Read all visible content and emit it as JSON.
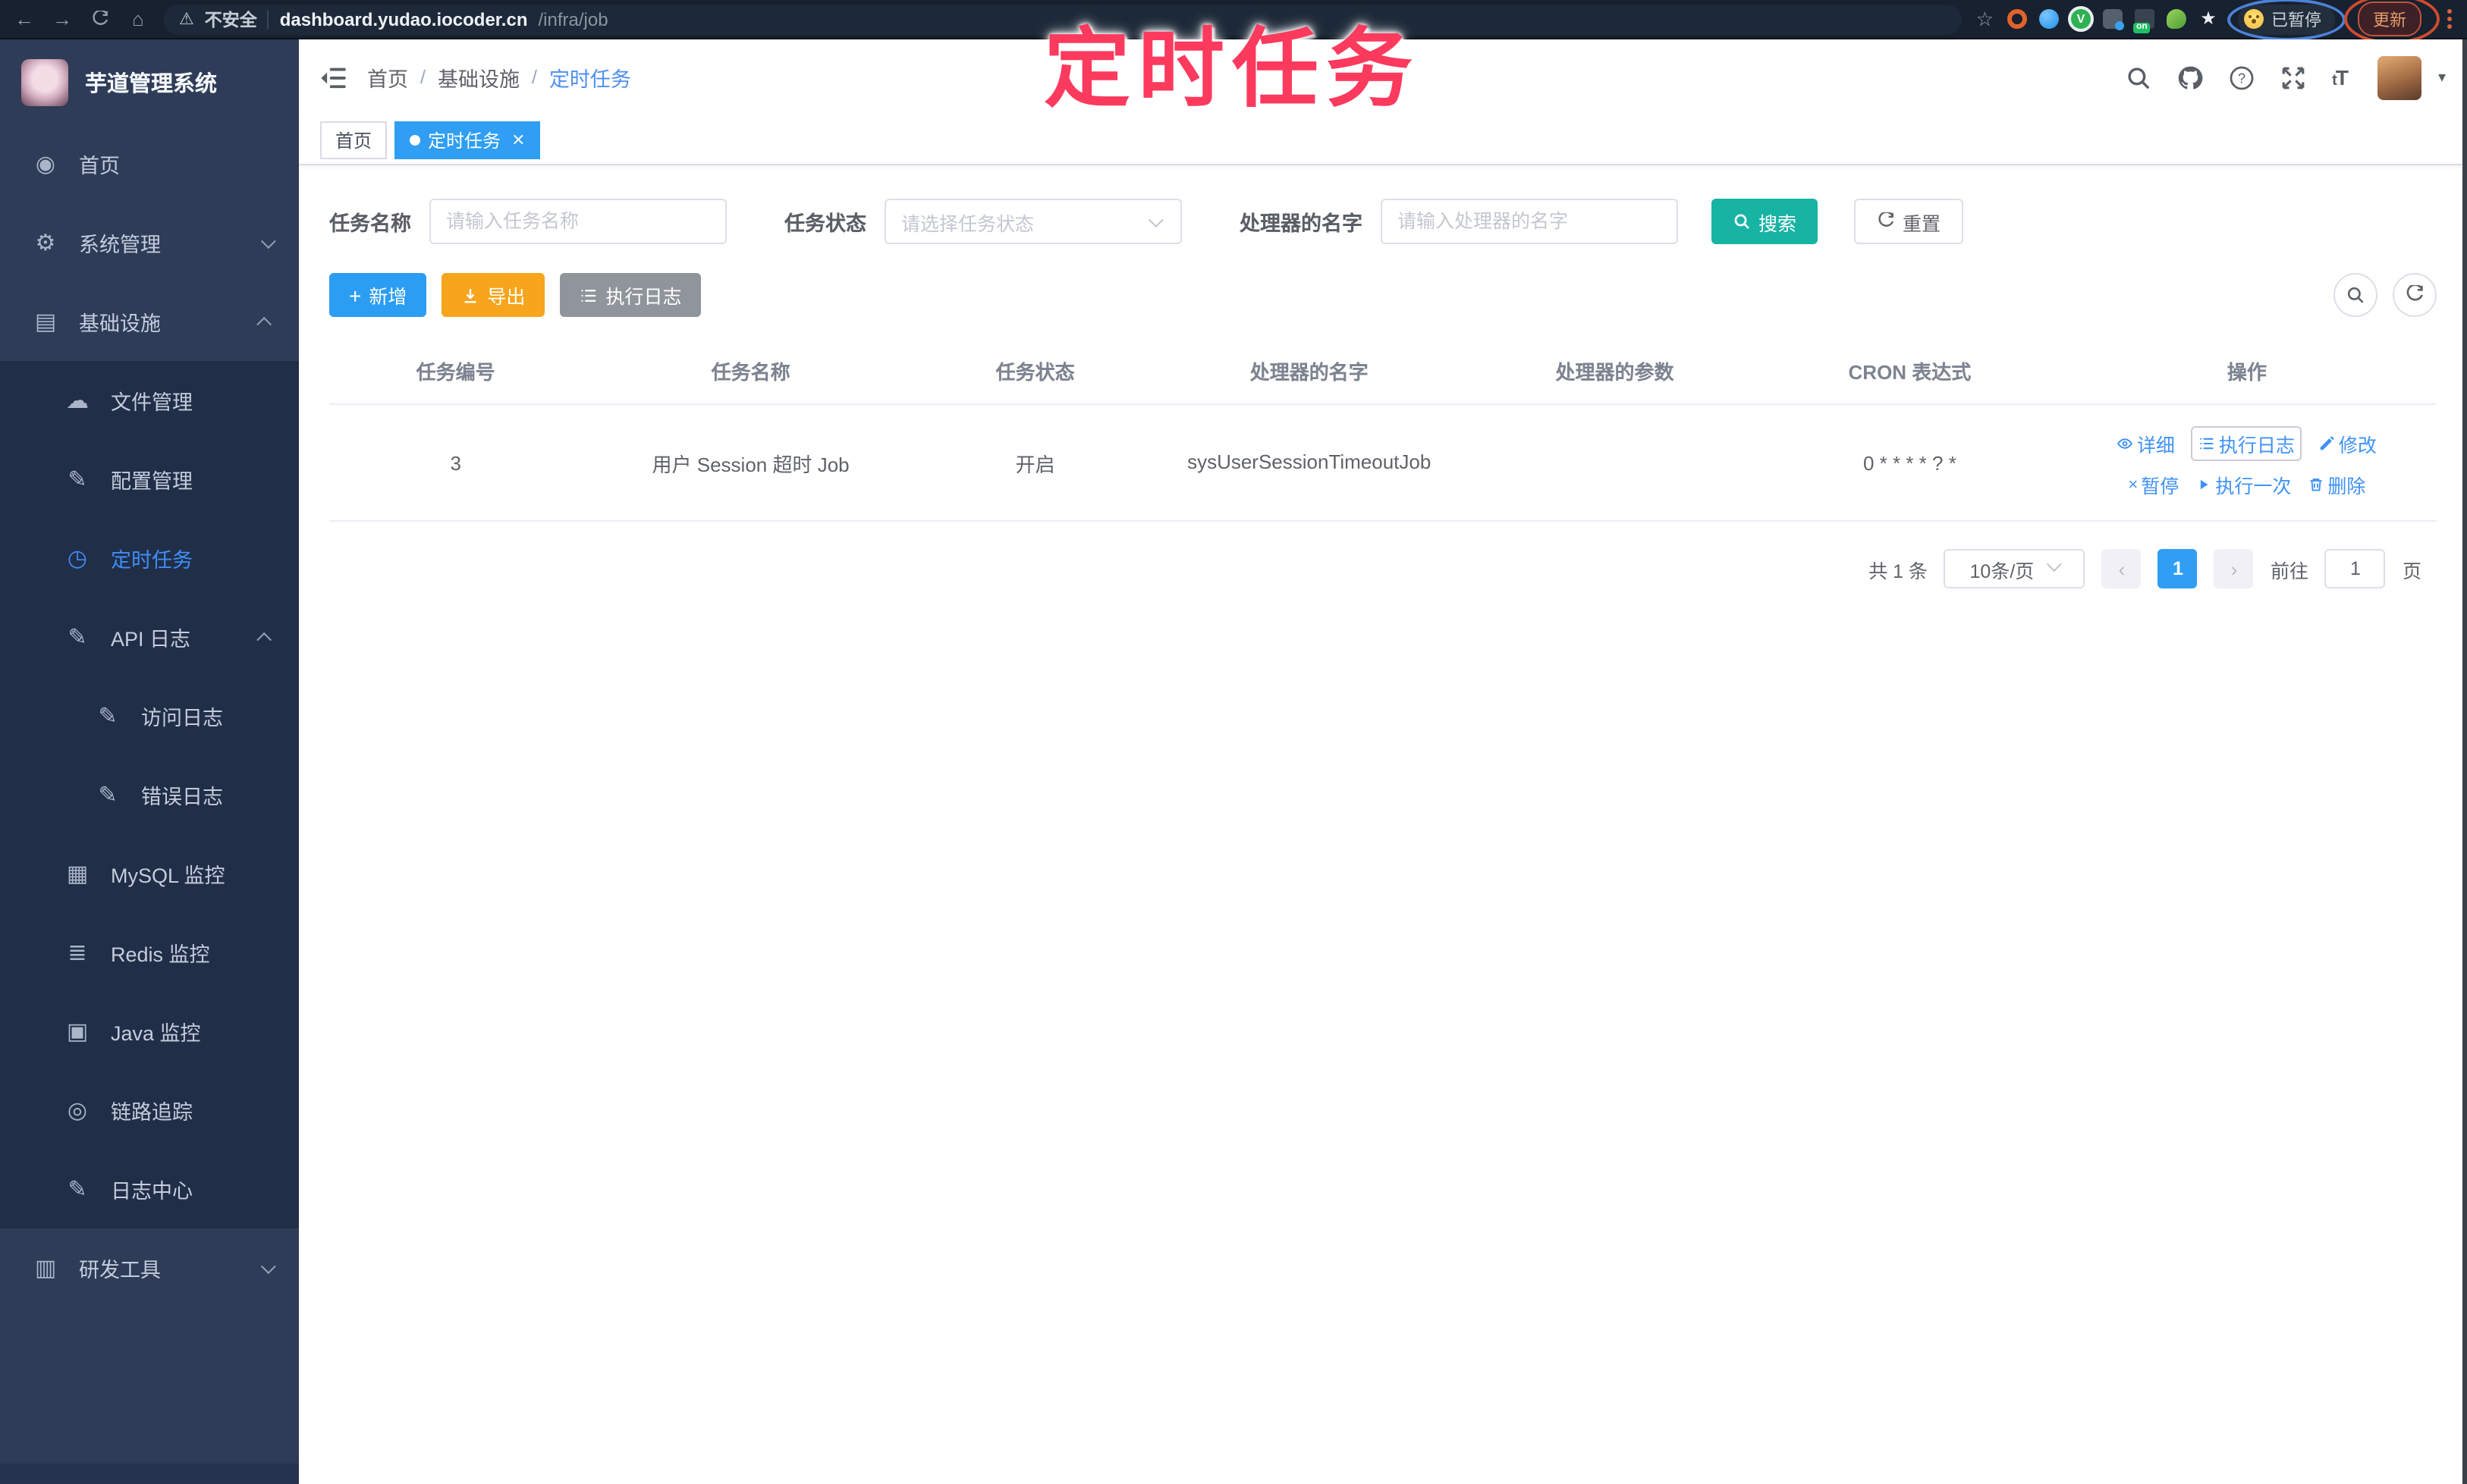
{
  "browser": {
    "security_label": "不安全",
    "url_host": "dashboard.yudao.iocoder.cn",
    "url_path": "/infra/job",
    "extension_on_badge": "on",
    "paused_badge": "已暂停",
    "update_label": "更新"
  },
  "annotation": {
    "title": "定时任务"
  },
  "sidebar": {
    "title": "芋道管理系统",
    "items": [
      {
        "label": "首页"
      },
      {
        "label": "系统管理"
      },
      {
        "label": "基础设施"
      },
      {
        "label": "文件管理"
      },
      {
        "label": "配置管理"
      },
      {
        "label": "定时任务"
      },
      {
        "label": "API 日志"
      },
      {
        "label": "访问日志"
      },
      {
        "label": "错误日志"
      },
      {
        "label": "MySQL 监控"
      },
      {
        "label": "Redis 监控"
      },
      {
        "label": "Java 监控"
      },
      {
        "label": "链路追踪"
      },
      {
        "label": "日志中心"
      },
      {
        "label": "研发工具"
      }
    ]
  },
  "header": {
    "breadcrumb": [
      "首页",
      "基础设施",
      "定时任务"
    ]
  },
  "tabs": [
    {
      "label": "首页"
    },
    {
      "label": "定时任务"
    }
  ],
  "filters": {
    "name_label": "任务名称",
    "name_placeholder": "请输入任务名称",
    "status_label": "任务状态",
    "status_placeholder": "请选择任务状态",
    "handler_label": "处理器的名字",
    "handler_placeholder": "请输入处理器的名字",
    "search_label": "搜索",
    "reset_label": "重置"
  },
  "toolbar": {
    "add_label": "新增",
    "export_label": "导出",
    "log_label": "执行日志"
  },
  "table": {
    "headers": [
      "任务编号",
      "任务名称",
      "任务状态",
      "处理器的名字",
      "处理器的参数",
      "CRON 表达式",
      "操作"
    ],
    "rows": [
      {
        "id": "3",
        "name": "用户 Session 超时 Job",
        "status": "开启",
        "handler": "sysUserSessionTimeoutJob",
        "params": "",
        "cron": "0 * * * * ? *"
      }
    ],
    "actions_row1": [
      "详细",
      "执行日志",
      "修改"
    ],
    "actions_row2": [
      "暂停",
      "执行一次",
      "删除"
    ]
  },
  "pagination": {
    "total": "共 1 条",
    "page_size": "10条/页",
    "current_page": "1",
    "goto_label": "前往",
    "goto_value": "1",
    "page_unit": "页"
  },
  "colors": {
    "accent": "#2f9ef3",
    "teal": "#17b3a3",
    "warning": "#f6a51c",
    "annotation_pink": "#fb3a5e"
  }
}
